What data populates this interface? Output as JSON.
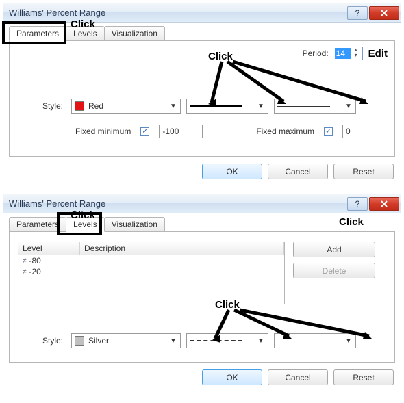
{
  "dialog1": {
    "title": "Williams' Percent Range",
    "tabs": {
      "parameters": "Parameters",
      "levels": "Levels",
      "visualization": "Visualization"
    },
    "active_tab": "parameters",
    "period": {
      "label": "Period:",
      "value": "14"
    },
    "style": {
      "label": "Style:",
      "color_name": "Red",
      "color_hex": "#e11313"
    },
    "fixed_min": {
      "label": "Fixed minimum",
      "checked": true,
      "value": "-100"
    },
    "fixed_max": {
      "label": "Fixed maximum",
      "checked": true,
      "value": "0"
    },
    "actions": {
      "ok": "OK",
      "cancel": "Cancel",
      "reset": "Reset"
    },
    "annotation": {
      "tab": "Click",
      "period": "Edit",
      "style": "Click"
    }
  },
  "dialog2": {
    "title": "Williams' Percent Range",
    "tabs": {
      "parameters": "Parameters",
      "levels": "Levels",
      "visualization": "Visualization"
    },
    "active_tab": "levels",
    "level_header": "Level",
    "desc_header": "Description",
    "levels": [
      {
        "value": "-80",
        "desc": ""
      },
      {
        "value": "-20",
        "desc": ""
      }
    ],
    "add": "Add",
    "delete": "Delete",
    "style": {
      "label": "Style:",
      "color_name": "Silver",
      "color_hex": "#c0c0c0"
    },
    "actions": {
      "ok": "OK",
      "cancel": "Cancel",
      "reset": "Reset"
    },
    "annotation": {
      "tab": "Click",
      "add": "Click",
      "style": "Click"
    }
  }
}
